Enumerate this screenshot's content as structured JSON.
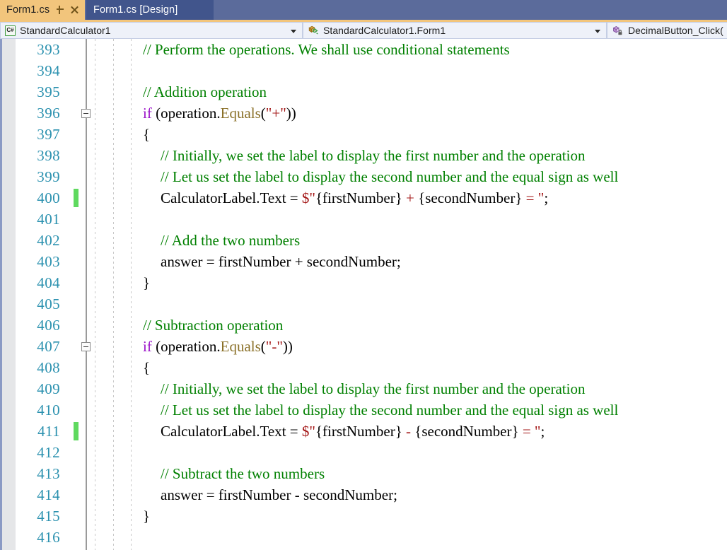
{
  "window": {
    "app": "Visual Studio Code Editor",
    "accent_tab_active": "#f2c57c",
    "accent_tab_inactive": "#41558c",
    "linenumber_color": "#2b91af",
    "comment_color": "#008000",
    "keyword_color": "#9b12c9",
    "string_color": "#a31515",
    "method_color": "#8a7028",
    "changebar_color": "#5fd95f"
  },
  "tabs": [
    {
      "label": "Form1.cs",
      "active": true,
      "pin_icon": "pin-icon",
      "close_icon": "close-icon"
    },
    {
      "label": "Form1.cs [Design]",
      "active": false
    }
  ],
  "navbar": {
    "project_selector": {
      "icon": "csharp-file-icon",
      "value": "StandardCalculator1"
    },
    "type_selector": {
      "icon": "class-icon",
      "value": "StandardCalculator1.Form1"
    },
    "member_selector": {
      "icon": "method-private-icon",
      "value": "DecimalButton_Click("
    }
  },
  "editor": {
    "first_line": 393,
    "last_line": 416,
    "fold_lines": [
      396,
      407
    ],
    "changed_lines": [
      400,
      411
    ],
    "lines": [
      {
        "n": 393,
        "indent": 0,
        "tokens": [
          {
            "t": "// Perform the operations. We shall use conditional statements",
            "c": "comment"
          }
        ]
      },
      {
        "n": 394,
        "indent": 0,
        "tokens": []
      },
      {
        "n": 395,
        "indent": 0,
        "tokens": [
          {
            "t": "// Addition operation",
            "c": "comment"
          }
        ]
      },
      {
        "n": 396,
        "indent": 0,
        "tokens": [
          {
            "t": "if",
            "c": "keyword"
          },
          {
            "t": " (operation.",
            "c": "plain"
          },
          {
            "t": "Equals",
            "c": "method"
          },
          {
            "t": "(",
            "c": "plain"
          },
          {
            "t": "\"+\"",
            "c": "string"
          },
          {
            "t": "))",
            "c": "plain"
          }
        ]
      },
      {
        "n": 397,
        "indent": 0,
        "tokens": [
          {
            "t": "{",
            "c": "plain"
          }
        ]
      },
      {
        "n": 398,
        "indent": 1,
        "tokens": [
          {
            "t": "// Initially, we set the label to display the first number and the operation",
            "c": "comment"
          }
        ]
      },
      {
        "n": 399,
        "indent": 1,
        "tokens": [
          {
            "t": "// Let us set the label to display the second number and the equal sign as well",
            "c": "comment"
          }
        ]
      },
      {
        "n": 400,
        "indent": 1,
        "tokens": [
          {
            "t": "CalculatorLabel.Text = ",
            "c": "plain"
          },
          {
            "t": "$\"",
            "c": "string"
          },
          {
            "t": "{firstNumber}",
            "c": "plain"
          },
          {
            "t": " + ",
            "c": "string"
          },
          {
            "t": "{secondNumber}",
            "c": "plain"
          },
          {
            "t": " = \"",
            "c": "string"
          },
          {
            "t": ";",
            "c": "plain"
          }
        ]
      },
      {
        "n": 401,
        "indent": 1,
        "tokens": []
      },
      {
        "n": 402,
        "indent": 1,
        "tokens": [
          {
            "t": "// Add the two numbers",
            "c": "comment"
          }
        ]
      },
      {
        "n": 403,
        "indent": 1,
        "tokens": [
          {
            "t": "answer = firstNumber + secondNumber;",
            "c": "plain"
          }
        ]
      },
      {
        "n": 404,
        "indent": 0,
        "tokens": [
          {
            "t": "}",
            "c": "plain"
          }
        ]
      },
      {
        "n": 405,
        "indent": 0,
        "tokens": []
      },
      {
        "n": 406,
        "indent": 0,
        "tokens": [
          {
            "t": "// Subtraction operation",
            "c": "comment"
          }
        ]
      },
      {
        "n": 407,
        "indent": 0,
        "tokens": [
          {
            "t": "if",
            "c": "keyword"
          },
          {
            "t": " (operation.",
            "c": "plain"
          },
          {
            "t": "Equals",
            "c": "method"
          },
          {
            "t": "(",
            "c": "plain"
          },
          {
            "t": "\"-\"",
            "c": "string"
          },
          {
            "t": "))",
            "c": "plain"
          }
        ]
      },
      {
        "n": 408,
        "indent": 0,
        "tokens": [
          {
            "t": "{",
            "c": "plain"
          }
        ]
      },
      {
        "n": 409,
        "indent": 1,
        "tokens": [
          {
            "t": "// Initially, we set the label to display the first number and the operation",
            "c": "comment"
          }
        ]
      },
      {
        "n": 410,
        "indent": 1,
        "tokens": [
          {
            "t": "// Let us set the label to display the second number and the equal sign as well",
            "c": "comment"
          }
        ]
      },
      {
        "n": 411,
        "indent": 1,
        "tokens": [
          {
            "t": "CalculatorLabel.Text = ",
            "c": "plain"
          },
          {
            "t": "$\"",
            "c": "string"
          },
          {
            "t": "{firstNumber}",
            "c": "plain"
          },
          {
            "t": " - ",
            "c": "string"
          },
          {
            "t": "{secondNumber}",
            "c": "plain"
          },
          {
            "t": " = \"",
            "c": "string"
          },
          {
            "t": ";",
            "c": "plain"
          }
        ]
      },
      {
        "n": 412,
        "indent": 1,
        "tokens": []
      },
      {
        "n": 413,
        "indent": 1,
        "tokens": [
          {
            "t": "// Subtract the two numbers",
            "c": "comment"
          }
        ]
      },
      {
        "n": 414,
        "indent": 1,
        "tokens": [
          {
            "t": "answer = firstNumber - secondNumber;",
            "c": "plain"
          }
        ]
      },
      {
        "n": 415,
        "indent": 0,
        "tokens": [
          {
            "t": "}",
            "c": "plain"
          }
        ]
      },
      {
        "n": 416,
        "indent": 0,
        "tokens": []
      }
    ]
  }
}
